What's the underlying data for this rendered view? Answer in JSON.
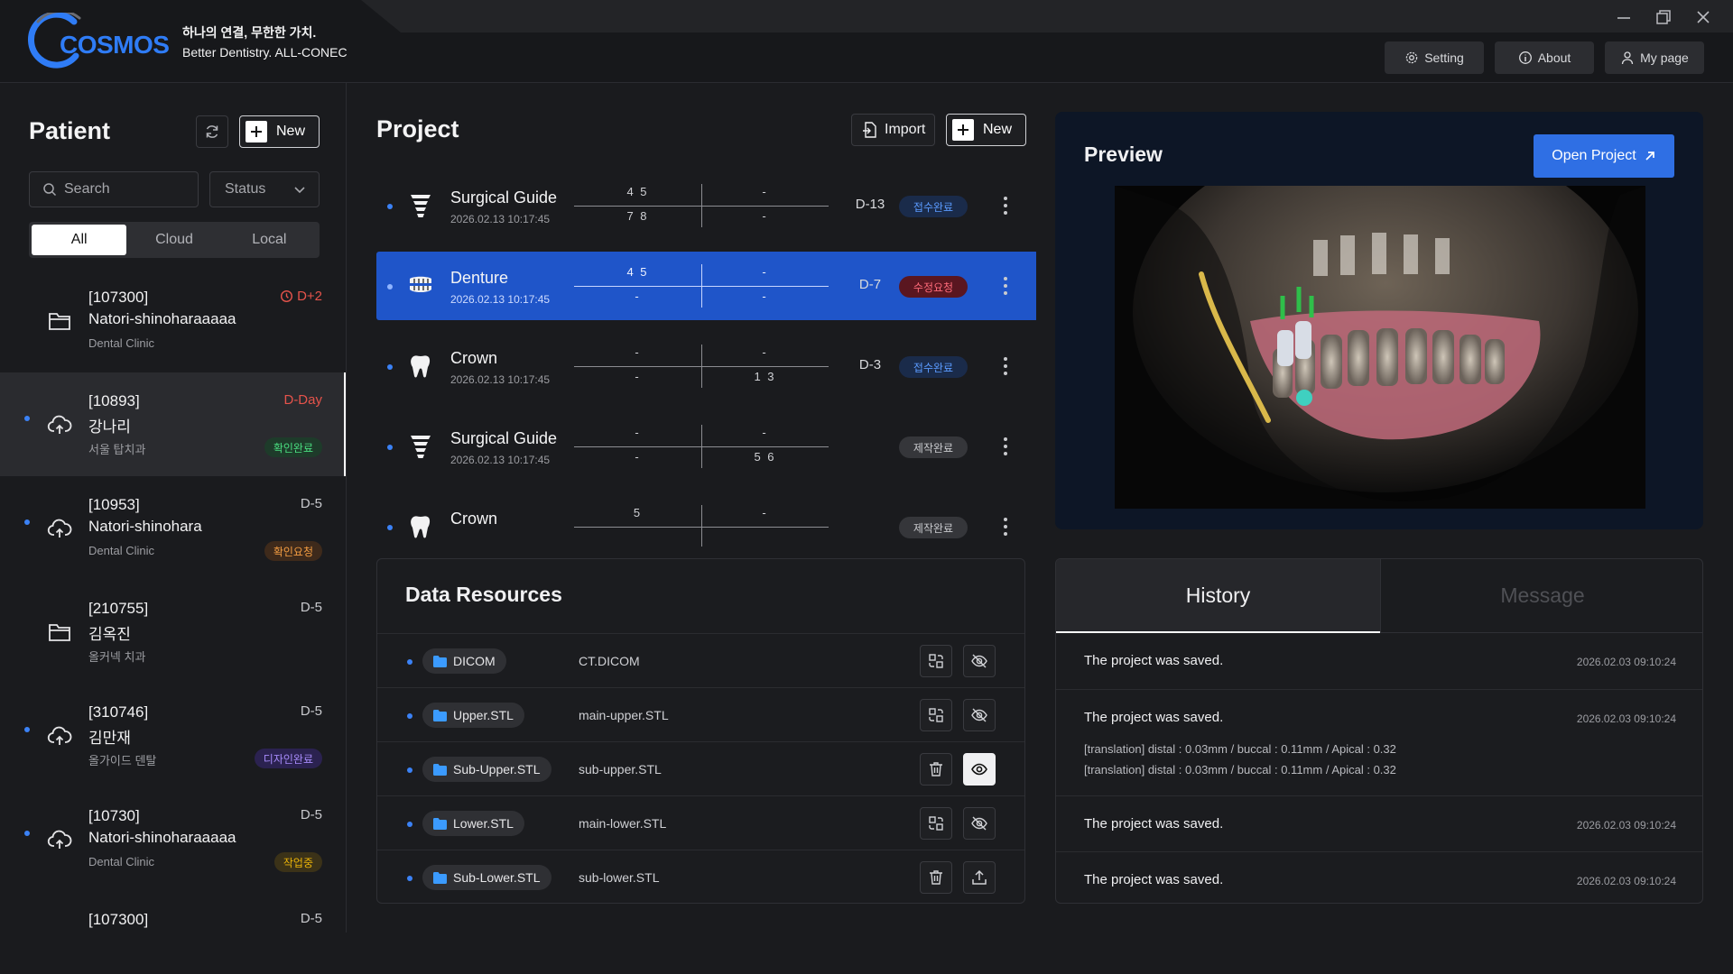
{
  "app": {
    "logo_text": "COSMOS",
    "tagline_ko": "하나의 연결, 무한한 가치.",
    "tagline_en": "Better Dentistry. ALL-CONEC",
    "accent": "#2f6fe4"
  },
  "header": {
    "setting": "Setting",
    "about": "About",
    "mypage": "My page"
  },
  "patient": {
    "title": "Patient",
    "new": "New",
    "search_placeholder": "Search",
    "status": "Status",
    "filters": [
      "All",
      "Cloud",
      "Local"
    ],
    "items": [
      {
        "id": "[107300]",
        "name": "Natori-shinoharaaaaa",
        "clinic": "Dental Clinic",
        "dday": "D+2",
        "badge": "",
        "icon": "folder-icon"
      },
      {
        "id": "[10893]",
        "name": "강나리",
        "clinic": "서울 탑치과",
        "dday": "D-Day",
        "badge": "확인완료",
        "icon": "cloud-upload-icon"
      },
      {
        "id": "[10953]",
        "name": "Natori-shinohara",
        "clinic": "Dental Clinic",
        "dday": "D-5",
        "badge": "확인요청",
        "icon": "cloud-upload-icon"
      },
      {
        "id": "[210755]",
        "name": "김옥진",
        "clinic": "올커넥 치과",
        "dday": "D-5",
        "badge": "",
        "icon": "folder-icon"
      },
      {
        "id": "[310746]",
        "name": "김만재",
        "clinic": "올가이드 덴탈",
        "dday": "D-5",
        "badge": "디자인완료",
        "icon": "cloud-upload-icon"
      },
      {
        "id": "[10730]",
        "name": "Natori-shinoharaaaaa",
        "clinic": "Dental Clinic",
        "dday": "D-5",
        "badge": "작업중",
        "icon": "cloud-upload-icon"
      },
      {
        "id": "[107300]",
        "name": "",
        "clinic": "",
        "dday": "D-5",
        "badge": "",
        "icon": "folder-icon"
      }
    ]
  },
  "project": {
    "title": "Project",
    "import": "Import",
    "new": "New",
    "rows": [
      {
        "name": "Surgical Guide",
        "date": "2026.02.13 10:17:45",
        "ul": "4 5",
        "ur": "-",
        "ll": "7 8",
        "lr": "-",
        "dday": "D-13",
        "status": "접수완료",
        "icon": "surgical-guide-icon"
      },
      {
        "name": "Denture",
        "date": "2026.02.13 10:17:45",
        "ul": "4 5",
        "ur": "-",
        "ll": "-",
        "lr": "-",
        "dday": "D-7",
        "status": "수정요청",
        "icon": "denture-icon"
      },
      {
        "name": "Crown",
        "date": "2026.02.13 10:17:45",
        "ul": "-",
        "ur": "-",
        "ll": "-",
        "lr": "1 3",
        "dday": "D-3",
        "status": "접수완료",
        "icon": "crown-icon"
      },
      {
        "name": "Surgical Guide",
        "date": "2026.02.13 10:17:45",
        "ul": "-",
        "ur": "-",
        "ll": "-",
        "lr": "5 6",
        "dday": "",
        "status": "제작완료",
        "icon": "surgical-guide-icon"
      },
      {
        "name": "Crown",
        "date": "",
        "ul": "5",
        "ur": "-",
        "ll": "",
        "lr": "",
        "dday": "",
        "status": "제작완료",
        "icon": "crown-icon"
      }
    ]
  },
  "resources": {
    "title": "Data Resources",
    "rows": [
      {
        "chip": "DICOM",
        "file": "CT.DICOM",
        "a": "swap-icon",
        "b": "eye-off-icon"
      },
      {
        "chip": "Upper.STL",
        "file": "main-upper.STL",
        "a": "swap-icon",
        "b": "eye-off-icon"
      },
      {
        "chip": "Sub-Upper.STL",
        "file": "sub-upper.STL",
        "a": "trash-icon",
        "b": "eye-icon"
      },
      {
        "chip": "Lower.STL",
        "file": "main-lower.STL",
        "a": "swap-icon",
        "b": "eye-off-icon"
      },
      {
        "chip": "Sub-Lower.STL",
        "file": "sub-lower.STL",
        "a": "trash-icon",
        "b": "upload-icon"
      }
    ]
  },
  "preview": {
    "title": "Preview",
    "open": "Open Project"
  },
  "history": {
    "tab_history": "History",
    "tab_message": "Message",
    "items": [
      {
        "text": "The project was saved.",
        "date": "2026.02.03 09:10:24",
        "details": []
      },
      {
        "text": "The project was saved.",
        "date": "2026.02.03 09:10:24",
        "details": [
          "[translation] distal : 0.03mm / buccal : 0.11mm / Apical : 0.32",
          "[translation] distal : 0.03mm / buccal : 0.11mm / Apical : 0.32"
        ]
      },
      {
        "text": "The project was saved.",
        "date": "2026.02.03 09:10:24",
        "details": []
      },
      {
        "text": "The project was saved.",
        "date": "2026.02.03 09:10:24",
        "details": []
      }
    ]
  }
}
